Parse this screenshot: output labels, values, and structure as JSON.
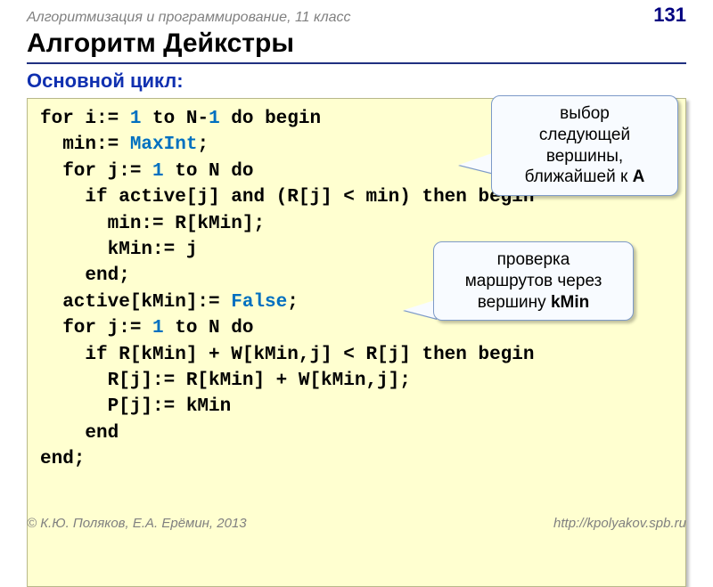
{
  "header": {
    "course": "Алгоритмизация и программирование, 11 класс",
    "page_number": "131"
  },
  "title": "Алгоритм Дейкстры",
  "subtitle": "Основной цикл:",
  "code": {
    "l1_a": "for i:= ",
    "l1_b": "1",
    "l1_c": " to N-",
    "l1_d": "1",
    "l1_e": " do begin",
    "l2_a": "  min:= ",
    "l2_b": "MaxInt",
    "l2_c": ";",
    "l3_a": "  for j:= ",
    "l3_b": "1",
    "l3_c": " to N do",
    "l4": "    if active[j] and (R[j] < min) then begin",
    "l5": "      min:= R[kMin];",
    "l6": "      kMin:= j",
    "l7": "    end;",
    "l8_a": "  active[kMin]:= ",
    "l8_b": "False",
    "l8_c": ";",
    "l9_a": "  for j:= ",
    "l9_b": "1",
    "l9_c": " to N do",
    "l10": "    if R[kMin] + W[kMin,j] < R[j] then begin",
    "l11": "      R[j]:= R[kMin] + W[kMin,j];",
    "l12": "      P[j]:= kMin",
    "l13": "    end",
    "l14": "end;"
  },
  "callouts": {
    "c1_line1": "выбор",
    "c1_line2": "следующей",
    "c1_line3": "вершины,",
    "c1_line4_a": "ближайшей к ",
    "c1_line4_b": "A",
    "c2_line1": "проверка",
    "c2_line2": "маршрутов через",
    "c2_line3_a": "вершину ",
    "c2_line3_b": "kMin"
  },
  "footer": {
    "left": "© К.Ю. Поляков, Е.А. Ерёмин, 2013",
    "right": "http://kpolyakov.spb.ru"
  }
}
